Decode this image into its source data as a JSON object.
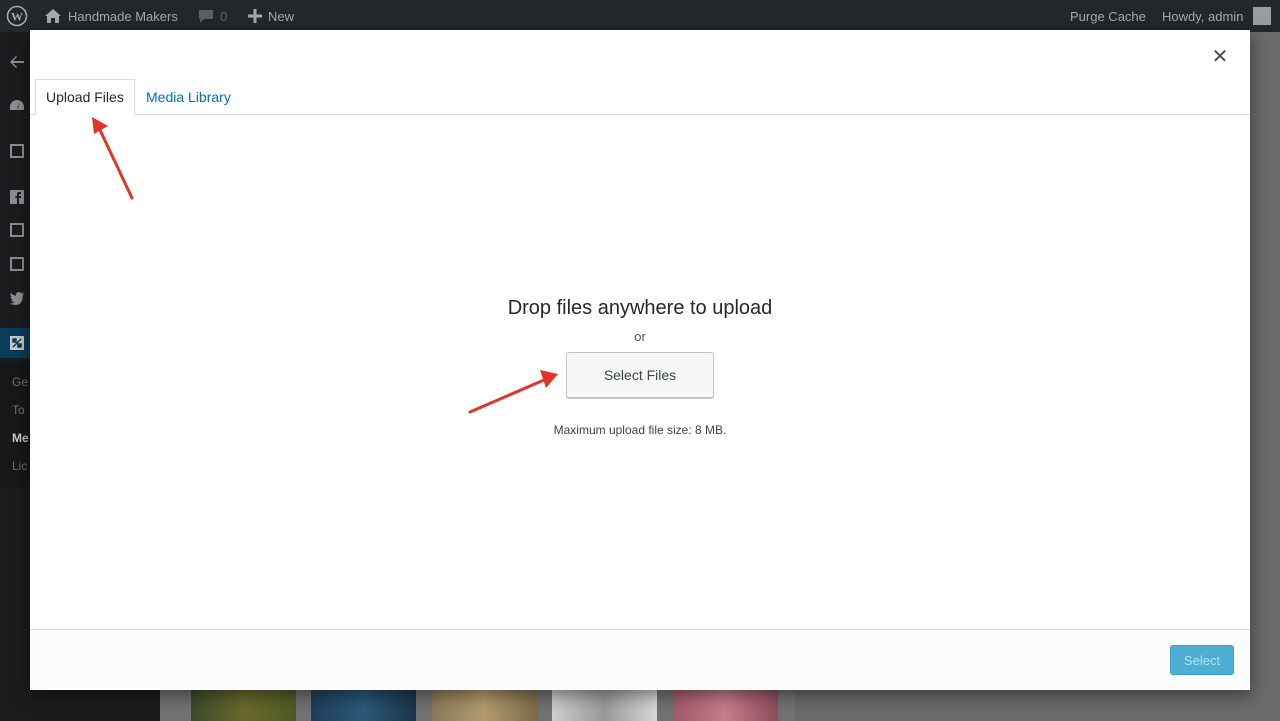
{
  "adminbar": {
    "site_name": "Handmade Makers",
    "comments_count": "0",
    "new_label": "New",
    "purge_cache": "Purge Cache",
    "howdy": "Howdy, admin"
  },
  "sidebar": {
    "submenu": [
      "Ge",
      "To",
      "Me",
      "Lic"
    ]
  },
  "modal": {
    "tabs": [
      {
        "label": "Upload Files",
        "active": true
      },
      {
        "label": "Media Library",
        "active": false
      }
    ],
    "uploader": {
      "title": "Drop files anywhere to upload",
      "or": "or",
      "button": "Select Files",
      "max_size": "Maximum upload file size: 8 MB."
    },
    "footer": {
      "select_button": "Select"
    }
  },
  "colors": {
    "adminbar_bg": "#23282d",
    "link_blue": "#0073aa",
    "primary_button": "#2ea2cc",
    "annotation_arrow": "#e0352b"
  }
}
